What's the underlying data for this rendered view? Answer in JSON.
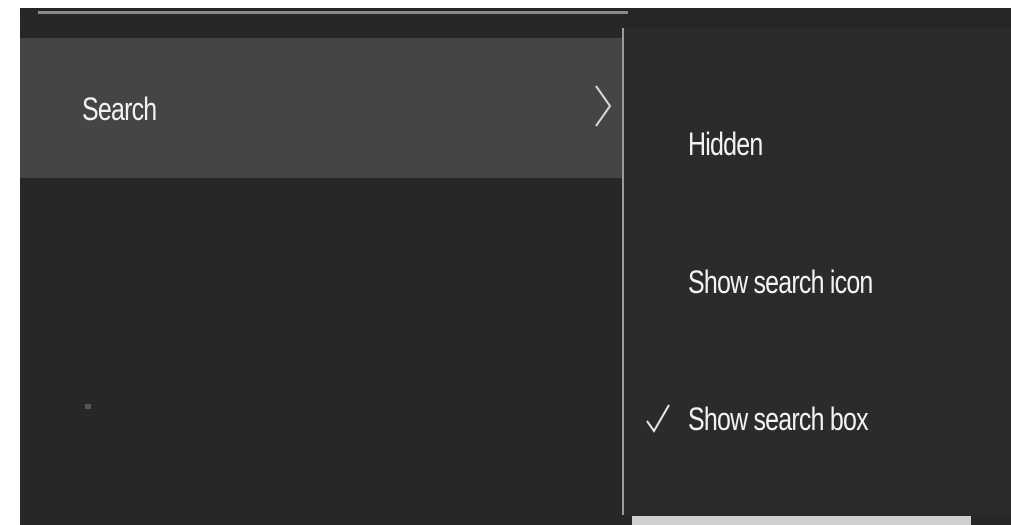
{
  "parent_menu": {
    "items": [
      {
        "label": "Search",
        "has_submenu": true,
        "icon": "chevron-right-icon"
      }
    ]
  },
  "submenu": {
    "items": [
      {
        "label": "Hidden",
        "checked": false
      },
      {
        "label": "Show search icon",
        "checked": false
      },
      {
        "label": "Show search box",
        "checked": true
      }
    ],
    "check_icon": "check-icon"
  },
  "colors": {
    "background": "#262626",
    "hover_item": "#454545",
    "submenu_background": "#2b2b2b",
    "text": "#f2f2f2",
    "border": "#9c9c9c"
  }
}
